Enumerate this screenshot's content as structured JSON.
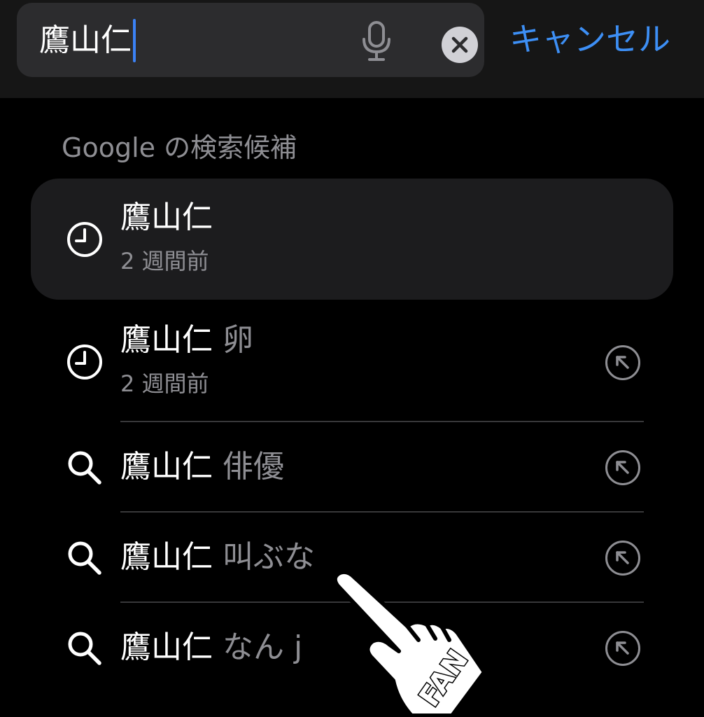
{
  "search": {
    "query": "鷹山仁",
    "cancel_label": "キャンセル"
  },
  "suggestions_header": "Google の検索候補",
  "rows": [
    {
      "icon": "clock-icon",
      "term": "鷹山仁",
      "suffix": "",
      "subtitle": "2 週間前",
      "highlighted": true,
      "has_arrow": false
    },
    {
      "icon": "clock-icon",
      "term": "鷹山仁",
      "suffix": "卵",
      "subtitle": "2 週間前",
      "highlighted": false,
      "has_arrow": true
    },
    {
      "icon": "search-icon",
      "term": "鷹山仁",
      "suffix": "俳優",
      "subtitle": "",
      "highlighted": false,
      "has_arrow": true
    },
    {
      "icon": "search-icon",
      "term": "鷹山仁",
      "suffix": "叫ぶな",
      "subtitle": "",
      "highlighted": false,
      "has_arrow": true
    },
    {
      "icon": "search-icon",
      "term": "鷹山仁",
      "suffix": "なん j",
      "subtitle": "",
      "highlighted": false,
      "has_arrow": true
    }
  ],
  "sticker": {
    "text": "FAN",
    "icon": "pointing-hand-icon"
  },
  "colors": {
    "accent": "#3d8ff5",
    "caret": "#3b82f6",
    "secondary_text": "#8e8e93",
    "search_field": "#2c2c2e",
    "highlight_row": "#1c1c1e"
  }
}
